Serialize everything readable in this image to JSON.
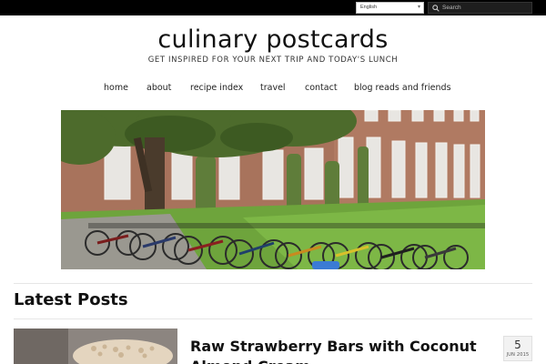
{
  "topbar": {
    "language_selected": "English",
    "search_placeholder": "Search"
  },
  "site": {
    "title": "culinary postcards",
    "tagline": "GET INSPIRED FOR YOUR NEXT TRIP AND TODAY'S LUNCH"
  },
  "nav": {
    "items": [
      {
        "label": "home"
      },
      {
        "label": "about"
      },
      {
        "label": "recipe index"
      },
      {
        "label": "travel"
      },
      {
        "label": "contact"
      },
      {
        "label": "blog reads and friends"
      }
    ]
  },
  "latest": {
    "heading": "Latest Posts",
    "posts": [
      {
        "title": "Raw Strawberry Bars with Coconut Almond Cream",
        "date_day": "5",
        "date_month": "JUN 2015"
      }
    ]
  },
  "icons": {
    "search": "search-icon",
    "dropdown": "chevron-down-icon"
  },
  "colors": {
    "topbar": "#000000",
    "search_bg": "#1e1e1e"
  }
}
